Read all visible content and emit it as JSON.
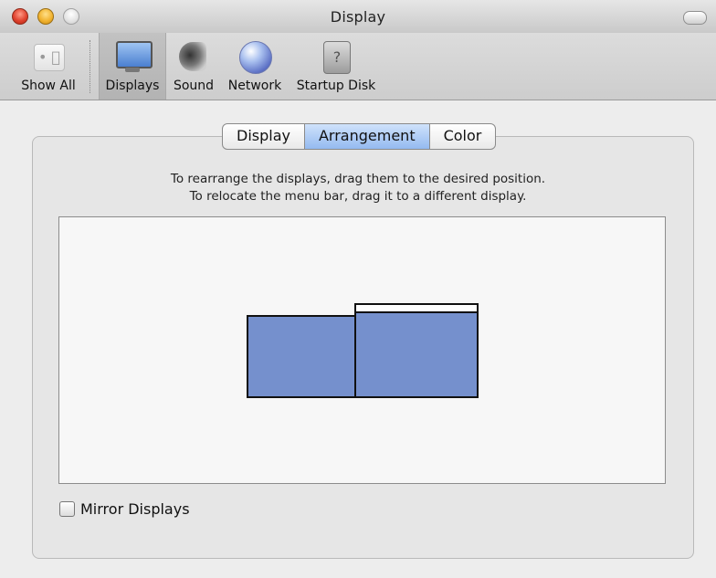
{
  "window": {
    "title": "Display"
  },
  "toolbar": {
    "items": [
      {
        "label": "Show All",
        "icon": "apple-logo-icon"
      },
      {
        "label": "Displays",
        "icon": "monitor-icon"
      },
      {
        "label": "Sound",
        "icon": "speaker-icon"
      },
      {
        "label": "Network",
        "icon": "globe-icon"
      },
      {
        "label": "Startup Disk",
        "icon": "hard-disk-icon"
      }
    ],
    "selected": "Displays"
  },
  "tabs": [
    {
      "label": "Display"
    },
    {
      "label": "Arrangement",
      "active": true
    },
    {
      "label": "Color"
    }
  ],
  "instructions": {
    "line1": "To rearrange the displays, drag them to the desired position.",
    "line2": "To relocate the menu bar, drag it to a different display."
  },
  "mirror": {
    "label": "Mirror Displays",
    "checked": false
  },
  "colors": {
    "display_fill": "#7590cd",
    "tab_active": "#94baf0"
  }
}
